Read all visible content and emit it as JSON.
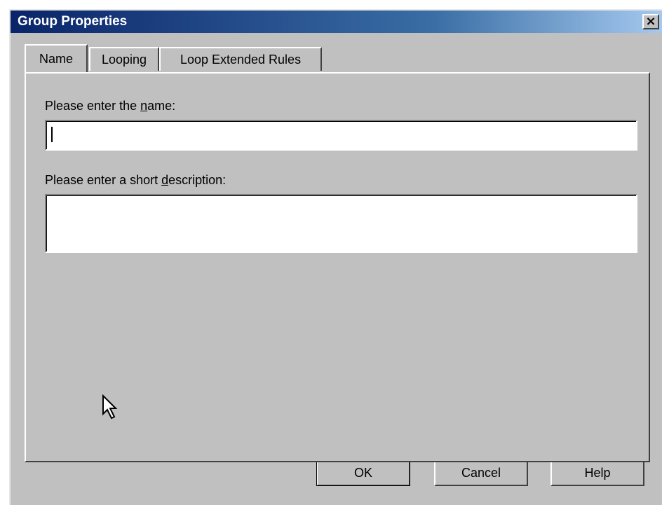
{
  "window": {
    "title": "Group Properties",
    "close_glyph": "×"
  },
  "tabs": [
    {
      "label": "Name",
      "active": true
    },
    {
      "label": "Looping",
      "active": false
    },
    {
      "label": "Loop Extended Rules",
      "active": false
    }
  ],
  "name_section": {
    "label_before": "Please enter the ",
    "label_mnemonic": "n",
    "label_after": "ame:",
    "value": ""
  },
  "description_section": {
    "label_before": "Please enter a short ",
    "label_mnemonic": "d",
    "label_after": "escription:",
    "value": ""
  },
  "buttons": {
    "ok": "OK",
    "cancel": "Cancel",
    "help": "Help"
  },
  "icons": {
    "close": "close-icon",
    "cursor": "mouse-pointer-icon"
  }
}
